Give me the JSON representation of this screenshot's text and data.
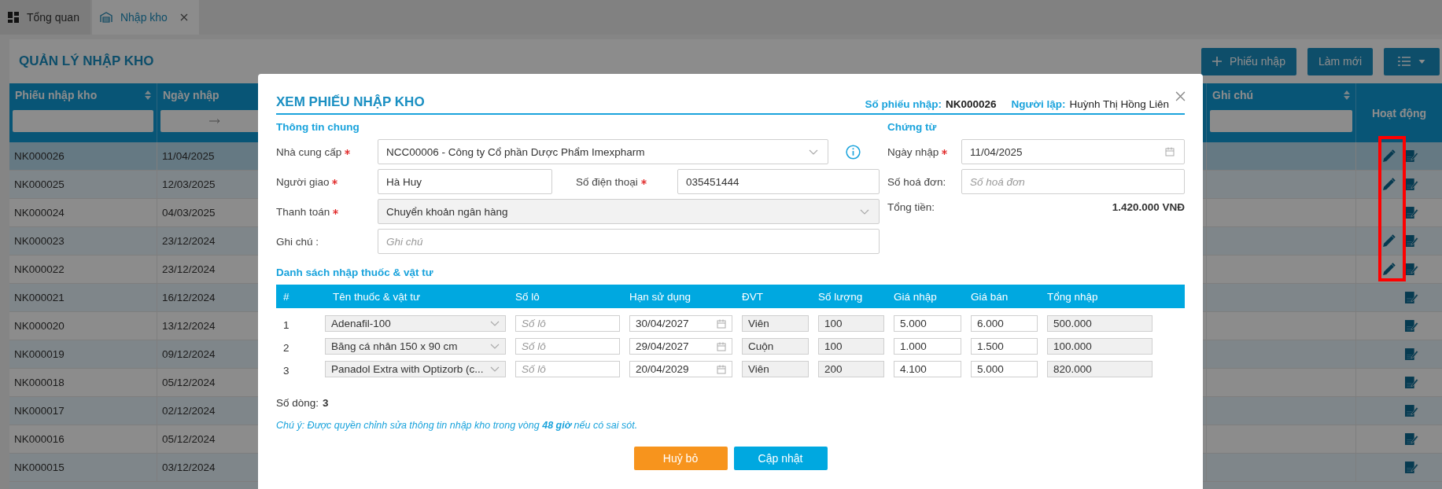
{
  "tabs": [
    {
      "label": "Tổng quan",
      "selected": false,
      "closable": false
    },
    {
      "label": "Nhập kho",
      "selected": true,
      "closable": true
    }
  ],
  "page": {
    "title": "QUẢN LÝ NHẬP KHO",
    "buttons": [
      {
        "kind": "add",
        "label": "Phiếu nhập"
      },
      {
        "kind": "plain",
        "label": "Làm mới"
      },
      {
        "kind": "columns"
      }
    ]
  },
  "table": {
    "columns": [
      {
        "label": "Phiếu nhập kho",
        "sortable": true,
        "kind": "text"
      },
      {
        "label": "Ngày nhập",
        "sortable": false,
        "kind": "date"
      },
      {
        "label": "Ghi chú",
        "sortable": true,
        "kind": "text"
      },
      {
        "label": "Hoạt động",
        "sortable": false,
        "kind": "actions"
      }
    ],
    "rows": [
      {
        "id": "NK000026",
        "date": "11/04/2025",
        "selected": true,
        "editable": true,
        "highlighted": true
      },
      {
        "id": "NK000025",
        "date": "12/03/2025",
        "selected": false,
        "editable": true,
        "highlighted": true
      },
      {
        "id": "NK000024",
        "date": "04/03/2025",
        "selected": false,
        "editable": false,
        "highlighted": true
      },
      {
        "id": "NK000023",
        "date": "23/12/2024",
        "selected": false,
        "editable": true,
        "highlighted": true
      },
      {
        "id": "NK000022",
        "date": "23/12/2024",
        "selected": false,
        "editable": true,
        "highlighted": true
      },
      {
        "id": "NK000021",
        "date": "16/12/2024",
        "selected": false,
        "editable": false,
        "highlighted": false
      },
      {
        "id": "NK000020",
        "date": "13/12/2024",
        "selected": false,
        "editable": false,
        "highlighted": false
      },
      {
        "id": "NK000019",
        "date": "09/12/2024",
        "selected": false,
        "editable": false,
        "highlighted": false
      },
      {
        "id": "NK000018",
        "date": "05/12/2024",
        "selected": false,
        "editable": false,
        "highlighted": false
      },
      {
        "id": "NK000017",
        "date": "02/12/2024",
        "selected": false,
        "editable": false,
        "highlighted": false
      },
      {
        "id": "NK000016",
        "date": "05/12/2024",
        "selected": false,
        "editable": false,
        "highlighted": false
      },
      {
        "id": "NK000015",
        "date": "03/12/2024",
        "selected": false,
        "editable": false,
        "highlighted": false
      }
    ]
  },
  "modal": {
    "title": "XEM PHIẾU NHẬP KHO",
    "meta": [
      {
        "label": "Số phiếu nhập:",
        "value": "NK000026"
      },
      {
        "label": "Người lập:",
        "value": "Huỳnh Thị Hồng Liên"
      }
    ],
    "general": {
      "heading": "Thông tin chung",
      "supplier": {
        "label": "Nhà cung cấp",
        "required": true,
        "value": "NCC00006 - Công ty Cổ phần Dược Phẩm Imexpharm"
      },
      "deliverer": {
        "label": "Người giao",
        "required": true,
        "value": "Hà Huy"
      },
      "phone": {
        "label": "Số điện thoại",
        "required": true,
        "value": "035451444"
      },
      "payment": {
        "label": "Thanh toán",
        "required": true,
        "value": "Chuyển khoản ngân hàng",
        "disabled": true
      },
      "note": {
        "label": "Ghi chú :",
        "required": false,
        "placeholder": "Ghi chú"
      }
    },
    "documents": {
      "heading": "Chứng từ",
      "date": {
        "label": "Ngày nhập",
        "required": true,
        "value": "11/04/2025"
      },
      "invoice": {
        "label": "Số hoá đơn:",
        "required": false,
        "placeholder": "Số hoá đơn"
      },
      "total": {
        "label": "Tổng tiền:",
        "value": "1.420.000 VNĐ"
      }
    },
    "items": {
      "heading": "Danh sách nhập thuốc & vật tư",
      "columns": [
        "#",
        "Tên thuốc & vật tư",
        "Số lô",
        "Hạn sử dụng",
        "ĐVT",
        "Số lượng",
        "Giá nhập",
        "Giá bán",
        "Tổng nhập"
      ],
      "rows": [
        {
          "index": "1",
          "name": "Adenafil-100",
          "lot_placeholder": "Số lô",
          "expiry": "30/04/2027",
          "unit": "Viên",
          "quantity": "100",
          "import_price": "5.000",
          "sale_price": "6.000",
          "total": "500.000"
        },
        {
          "index": "2",
          "name": "Băng cá nhân 150 x 90 cm",
          "lot_placeholder": "Số lô",
          "expiry": "29/04/2027",
          "unit": "Cuộn",
          "quantity": "100",
          "import_price": "1.000",
          "sale_price": "1.500",
          "total": "100.000"
        },
        {
          "index": "3",
          "name": "Panadol Extra with Optizorb (c...",
          "lot_placeholder": "Số lô",
          "expiry": "20/04/2029",
          "unit": "Viên",
          "quantity": "200",
          "import_price": "4.100",
          "sale_price": "5.000",
          "total": "820.000"
        }
      ]
    },
    "row_count": {
      "label": "Số dòng:",
      "value": "3"
    },
    "notice": "Chú ý: Được quyền chỉnh sửa thông tin nhập kho trong vòng **48 giờ** nếu có sai sót.",
    "buttons": [
      {
        "kind": "cancel",
        "label": "Huỷ bỏ"
      },
      {
        "kind": "submit",
        "label": "Cập nhật"
      }
    ]
  }
}
